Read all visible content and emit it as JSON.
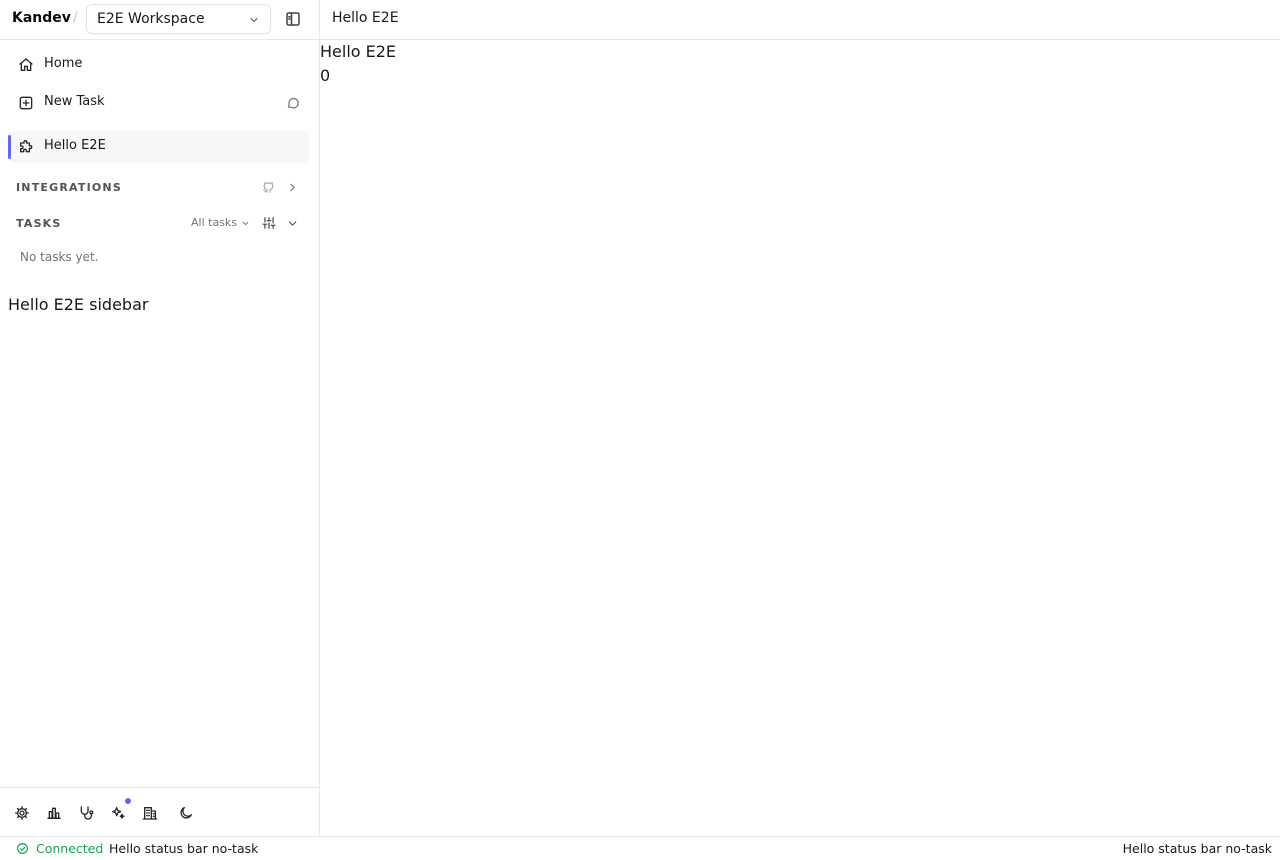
{
  "app": {
    "brand": "Kandev",
    "separator": "/"
  },
  "workspace": {
    "selected": "E2E Workspace"
  },
  "sidebar": {
    "nav": [
      {
        "label": "Home",
        "icon": "home-icon"
      },
      {
        "label": "New Task",
        "icon": "plus-square-icon",
        "trailing_icon": "chat-bubble-icon"
      },
      {
        "label": "Hello E2E",
        "icon": "puzzle-icon",
        "active": true
      }
    ],
    "integrations": {
      "title": "INTEGRATIONS",
      "icons": [
        "github-icon",
        "chevron-right-icon"
      ]
    },
    "tasks": {
      "title": "TASKS",
      "filter_label": "All tasks",
      "empty_text": "No tasks yet."
    },
    "plugin_text": "Hello E2E sidebar",
    "footer_icons": [
      "settings-icon",
      "stats-icon",
      "health-icon",
      "sparkles-icon",
      "office-icon",
      "moon-icon"
    ]
  },
  "main": {
    "header_title": "Hello E2E",
    "content_title": "Hello E2E",
    "count": "0"
  },
  "status_bar": {
    "connection": "Connected",
    "left_text": "Hello status bar no-task",
    "right_text": "Hello status bar no-task"
  },
  "colors": {
    "accent": "#6366f1",
    "connected": "#16a34a",
    "border": "#e5e7eb"
  }
}
